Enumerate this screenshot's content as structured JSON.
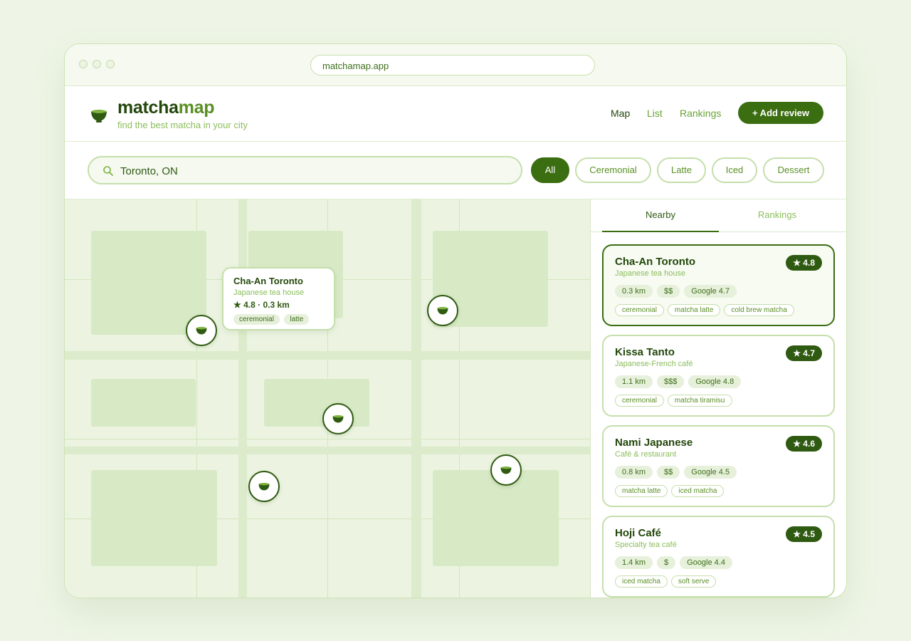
{
  "browser": {
    "url": "matchamap.app"
  },
  "header": {
    "logo_part1": "matcha",
    "logo_part2": "map",
    "tagline": "find the best matcha in your city",
    "nav": [
      {
        "label": "Map",
        "active": true
      },
      {
        "label": "List",
        "active": false
      },
      {
        "label": "Rankings",
        "active": false
      }
    ],
    "add_review_label": "+ Add review"
  },
  "search": {
    "value": "Toronto, ON"
  },
  "filters": [
    {
      "label": "All",
      "active": true
    },
    {
      "label": "Ceremonial",
      "active": false
    },
    {
      "label": "Latte",
      "active": false
    },
    {
      "label": "Iced",
      "active": false
    },
    {
      "label": "Dessert",
      "active": false
    }
  ],
  "map": {
    "popup": {
      "name": "Cha-An Toronto",
      "type": "Japanese tea house",
      "meta": "★ 4.8 · 0.3 km",
      "tags": [
        "ceremonial",
        "latte"
      ]
    },
    "pin_icon": "matcha-bowl-icon"
  },
  "panel": {
    "tabs": [
      {
        "label": "Nearby",
        "active": true
      },
      {
        "label": "Rankings",
        "active": false
      }
    ],
    "cards": [
      {
        "name": "Cha-An Toronto",
        "type": "Japanese tea house",
        "rating": "★ 4.8",
        "distance": "0.3 km",
        "price": "$$",
        "google": "Google 4.7",
        "tags": [
          "ceremonial",
          "matcha latte",
          "cold brew matcha"
        ],
        "selected": true
      },
      {
        "name": "Kissa Tanto",
        "type": "Japanese-French café",
        "rating": "★ 4.7",
        "distance": "1.1 km",
        "price": "$$$",
        "google": "Google 4.8",
        "tags": [
          "ceremonial",
          "matcha tiramisu"
        ],
        "selected": false
      },
      {
        "name": "Nami Japanese",
        "type": "Café & restaurant",
        "rating": "★ 4.6",
        "distance": "0.8 km",
        "price": "$$",
        "google": "Google 4.5",
        "tags": [
          "matcha latte",
          "iced matcha"
        ],
        "selected": false
      },
      {
        "name": "Hoji Café",
        "type": "Specialty tea café",
        "rating": "★ 4.5",
        "distance": "1.4 km",
        "price": "$",
        "google": "Google 4.4",
        "tags": [
          "iced matcha",
          "soft serve"
        ],
        "selected": false
      }
    ]
  },
  "colors": {
    "accent": "#3b6d11",
    "dark": "#23470b",
    "muted": "#8bbd5b",
    "border": "#c5dfab"
  }
}
